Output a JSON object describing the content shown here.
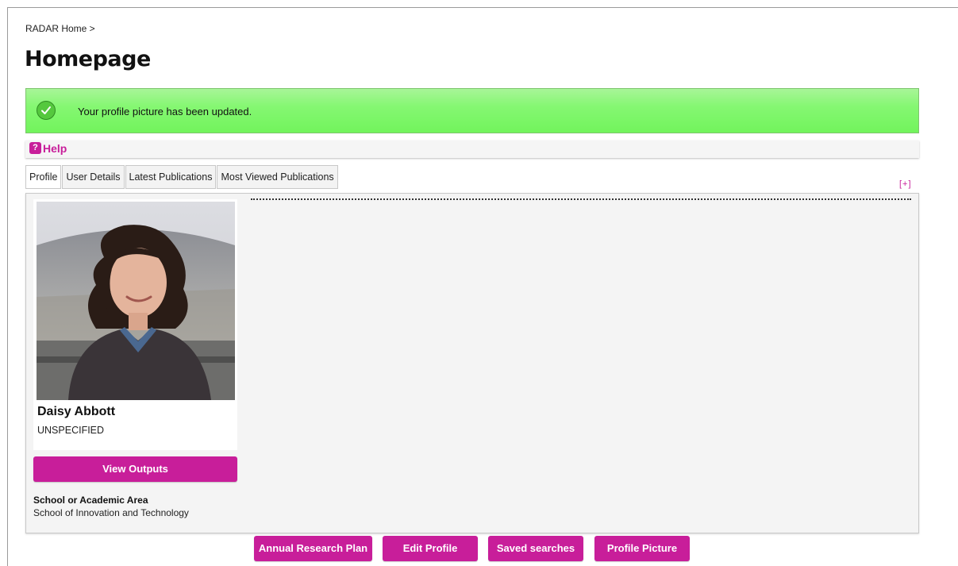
{
  "breadcrumb": {
    "text": "RADAR Home >"
  },
  "page": {
    "title": "Homepage"
  },
  "alert": {
    "message": "Your profile picture has been updated.",
    "icon": "checkmark-icon",
    "color": "#72f45c"
  },
  "help": {
    "label": "Help",
    "icon_glyph": "?",
    "icon": "help-icon"
  },
  "tabs": [
    {
      "label": "Profile"
    },
    {
      "label": "User Details"
    },
    {
      "label": "Latest Publications"
    },
    {
      "label": "Most Viewed Publications"
    }
  ],
  "expand_toggle": {
    "label": "[+]"
  },
  "profile": {
    "name": "Daisy Abbott",
    "role": "UNSPECIFIED",
    "view_outputs_label": "View Outputs",
    "school_label": "School or Academic Area",
    "school_value": "School of Innovation and Technology"
  },
  "actions": {
    "annual_research_plan": "Annual Research Plan",
    "edit_profile": "Edit Profile",
    "saved_searches": "Saved searches",
    "profile_picture": "Profile Picture"
  },
  "colors": {
    "accent": "#c81e9a",
    "panel_bg": "#f4f4f4"
  }
}
